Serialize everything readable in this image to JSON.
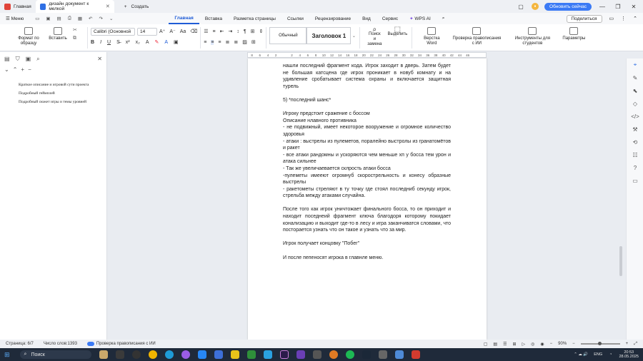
{
  "titlebar": {
    "home_tab": "Главная",
    "doc_tab": "дизайн документ  к мелкой",
    "new_tab": "Создать",
    "update_btn": "Обновить сейчас"
  },
  "menubar": {
    "menu": "Меню",
    "items": [
      "Главная",
      "Вставка",
      "Разметка страницы",
      "Ссылки",
      "Рецензирование",
      "Вид",
      "Сервис",
      "WPS AI"
    ],
    "share": "Поделиться"
  },
  "ribbon": {
    "format_painter": "Формат по образцу",
    "paste": "Вставить",
    "font_name": "Calibri (Основной",
    "font_size": "14",
    "style_normal": "Обычный",
    "style_heading": "Заголовок 1",
    "find": "Поиск и замена",
    "select": "Выделить",
    "word_layout": "Верстка Word",
    "spellcheck": "Проверка правописания с ИИ",
    "ai_tools": "Инструменты для студентов",
    "params": "Параметры"
  },
  "ruler": [
    "8",
    "6",
    "4",
    "2",
    "",
    "2",
    "4",
    "6",
    "8",
    "10",
    "12",
    "14",
    "16",
    "18",
    "20",
    "22",
    "24",
    "26",
    "28",
    "30",
    "32",
    "34",
    "36",
    "38",
    "40",
    "42",
    "44",
    "46"
  ],
  "nav": {
    "items": [
      "Краткое описание и игровой сути проекта",
      "Подробный геймплей",
      "Подробный сюжет игры и темы уровней"
    ]
  },
  "doc": {
    "paragraphs": [
      "нашли последний фрагмент кода. Игрок заходит в дверь. Затем будет не большая катсцена где игрок проникает в новуб комнату и на удивление сробатывает система охраны и включается защитная турель",
      "",
      "5) *последний шанс*",
      "",
      "Игроку предстоит сражение с боссом",
      "Описание нлавного противника",
      "- не подвижный, имеет некоторое вооружение и огромное количество здоровья",
      "- атаки : выстрелы из пулеметов, поралейно выстролы из гранатомётов и ракет",
      "- все атаки рандомны и ускоряются чем меньше хп у босса тем урон и атака сильнее",
      "- Так же увеличаевается склрость атаки босса",
      "-пулеметы имееют огромнуб скорострельность и  конесу образные выстрелы",
      "- ракетометы стреляют в ту точку где стоял последниб секунду игрок, стрельба между атаками случайна.",
      "",
      "После того как игрок уничтожает финального босса, то он приходит и находит поседнеий фрагмент ключа благодоря которому покидает конализацию и выходит где-то в лесу и игра заканчиватся словами, что постоpается узнать что он такое и узнать что за мир.",
      "",
      "Игрок получает концовку \"Побег\"",
      "",
      "И после пепеносят игрока в главнле меню."
    ]
  },
  "status": {
    "page": "Страница: 6/7",
    "words": "Число слов:1393",
    "spell": "Проверка правописания с ИИ",
    "zoom": "90%"
  },
  "taskbar": {
    "search": "Поиск",
    "time": "20:53",
    "date": "28.05.2025",
    "lang": "ENG"
  }
}
